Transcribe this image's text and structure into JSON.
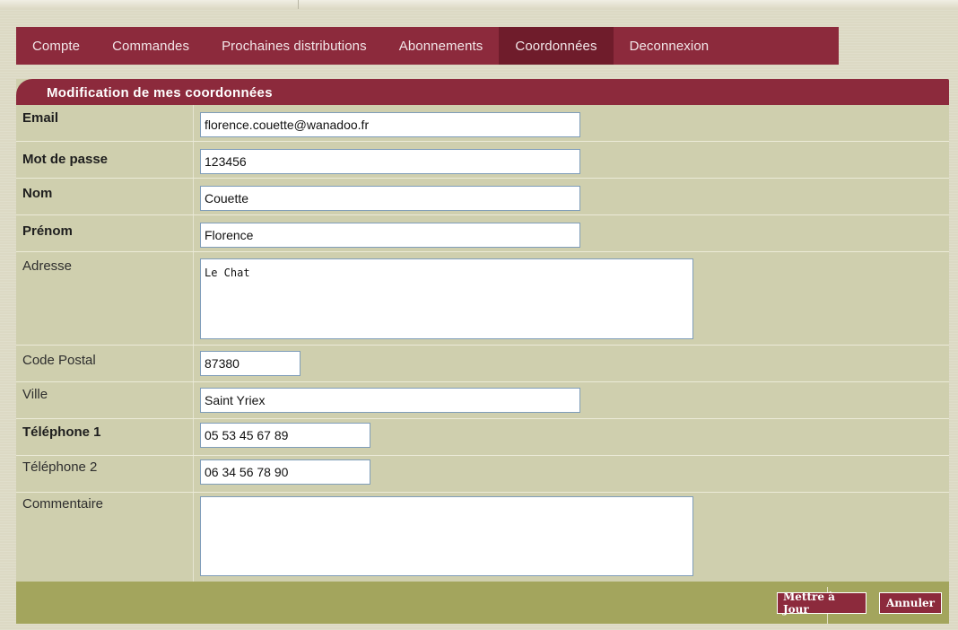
{
  "nav": {
    "items": [
      {
        "label": "Compte"
      },
      {
        "label": "Commandes"
      },
      {
        "label": "Prochaines distributions"
      },
      {
        "label": "Abonnements"
      },
      {
        "label": "Coordonnées",
        "active": true
      },
      {
        "label": "Deconnexion"
      }
    ]
  },
  "form": {
    "title": "Modification de mes coordonnées",
    "email": {
      "label": "Email",
      "value": "florence.couette@wanadoo.fr"
    },
    "password": {
      "label": "Mot de passe",
      "value": "123456"
    },
    "nom": {
      "label": "Nom",
      "value": "Couette"
    },
    "prenom": {
      "label": "Prénom",
      "value": "Florence"
    },
    "adresse": {
      "label": "Adresse",
      "value": "Le Chat"
    },
    "code_postal": {
      "label": "Code Postal",
      "value": "87380"
    },
    "ville": {
      "label": "Ville",
      "value": "Saint Yriex"
    },
    "telephone1": {
      "label": "Téléphone 1",
      "value": "05 53 45 67 89"
    },
    "telephone2": {
      "label": "Téléphone 2",
      "value": "06 34 56 78 90"
    },
    "commentaire": {
      "label": "Commentaire",
      "value": ""
    }
  },
  "buttons": {
    "update": "Mettre à Jour",
    "cancel": "Annuler"
  },
  "colors": {
    "brand": "#8c2a3c",
    "panel": "#cfcfae",
    "footer": "#a3a55d"
  }
}
